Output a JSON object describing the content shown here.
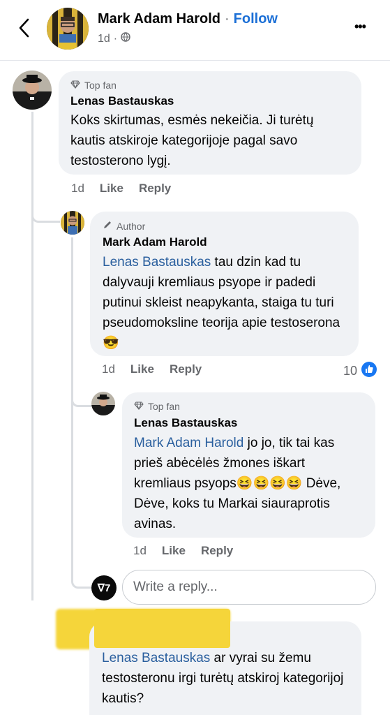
{
  "header": {
    "author": "Mark Adam Harold",
    "separator": "·",
    "follow": "Follow",
    "time": "1d",
    "dot": "·",
    "more": "•••"
  },
  "comments": [
    {
      "badge": "Top fan",
      "name": "Lenas Bastauskas",
      "text": "Koks skirtumas, esmės nekeičia. Ji turėtų kautis atskiroje kategorijoje pagal savo testosterono lygį.",
      "time": "1d",
      "like": "Like",
      "reply": "Reply"
    },
    {
      "badge": "Author",
      "name": "Mark Adam Harold",
      "mention": "Lenas Bastauskas",
      "text": " tau dzin kad tu dalyvauji kremliaus psyope ir padedi putinui skleist neapykanta, staiga tu turi pseudomoksline teorija apie testoserona",
      "emoji": "😎",
      "time": "1d",
      "like": "Like",
      "reply": "Reply",
      "reactions": "10"
    },
    {
      "badge": "Top fan",
      "name": "Lenas Bastauskas",
      "mention": "Mark Adam Harold",
      "text": " jo jo, tik tai kas prieš abėcėlės žmones iškart kremliaus psyops",
      "emoji": "😆😆😆😆",
      "text2": "Dėve, Dėve, koks tu Markai siauraprotis avinas.",
      "time": "1d",
      "like": "Like",
      "reply": "Reply"
    },
    {
      "mention": "Lenas Bastauskas",
      "text": " ar vyrai su žemu testosteronu irgi turėtų atskiroj kategorijoj kautis?"
    }
  ],
  "reply_box": {
    "placeholder": "Write a reply...",
    "avatar_text": "ᐁ7"
  }
}
